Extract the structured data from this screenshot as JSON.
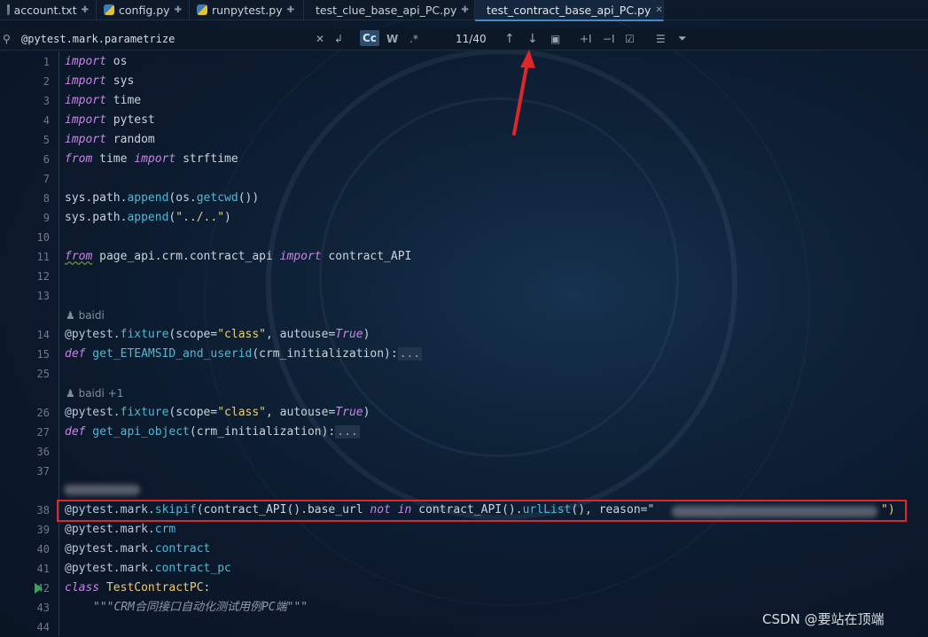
{
  "tabs": [
    {
      "label": "account.txt",
      "icon": "text-file-icon",
      "active": false
    },
    {
      "label": "config.py",
      "icon": "python-file-icon",
      "active": false
    },
    {
      "label": "runpytest.py",
      "icon": "python-file-icon",
      "active": false
    },
    {
      "label": "test_clue_base_api_PC.py",
      "icon": "python-file-icon",
      "active": false
    },
    {
      "label": "test_contract_base_api_PC.py",
      "icon": "python-file-icon",
      "active": true
    }
  ],
  "search": {
    "query": "@pytest.mark.parametrize",
    "match_case_label": "Cc",
    "words_label": "W",
    "regex_label": ".*",
    "result_count": "11/40"
  },
  "editor": {
    "line_numbers": [
      "1",
      "2",
      "3",
      "4",
      "5",
      "6",
      "7",
      "8",
      "9",
      "10",
      "11",
      "12",
      "13",
      "14",
      "15",
      "25",
      "26",
      "27",
      "36",
      "37",
      "38",
      "39",
      "40",
      "41",
      "42",
      "43",
      "44"
    ],
    "author_hints": [
      "baidi",
      "baidi +1"
    ],
    "lines": {
      "l1": {
        "kw": "import",
        "rest": " os"
      },
      "l2": {
        "kw": "import",
        "rest": " sys"
      },
      "l3": {
        "kw": "import",
        "rest": " time"
      },
      "l4": {
        "kw": "import",
        "rest": " pytest"
      },
      "l5": {
        "kw": "import",
        "rest": " random"
      },
      "l6": {
        "kw1": "from",
        "mid": " time ",
        "kw2": "import",
        "rest": " strftime"
      },
      "l8": {
        "a": "sys.path.",
        "fn1": "append",
        "b": "(os.",
        "fn2": "getcwd",
        "c": "())"
      },
      "l9": {
        "a": "sys.path.",
        "fn1": "append",
        "b": "(",
        "str": "\"../..\"",
        "c": ")"
      },
      "l11": {
        "kw1": "from",
        "mid": " page_api.crm.contract_api ",
        "kw2": "import",
        "rest": " contract_API"
      },
      "l14": {
        "dec": "@pytest.",
        "fn": "fixture",
        "a": "(scope=",
        "str": "\"class\"",
        "b": ", autouse=",
        "bool": "True",
        "c": ")"
      },
      "l15": {
        "kw": "def",
        "name": " get_ETEAMSID_and_userid",
        "args": "(crm_initialization):",
        "fold": "..."
      },
      "l26": {
        "dec": "@pytest.",
        "fn": "fixture",
        "a": "(scope=",
        "str": "\"class\"",
        "b": ", autouse=",
        "bool": "True",
        "c": ")"
      },
      "l27": {
        "kw": "def",
        "name": " get_api_object",
        "args": "(crm_initialization):",
        "fold": "..."
      },
      "l38": {
        "dec": "@pytest.mark.",
        "fn": "skipif",
        "a": "(contract_API().base_url ",
        "kw1": "not",
        "b": " ",
        "kw2": "in",
        "c": " contract_API().",
        "fn2": "urlList",
        "d": "(), reason=",
        "str_start": "\"",
        "str_end": "\")"
      },
      "l39": {
        "dec": "@pytest.mark.",
        "fn": "crm"
      },
      "l40": {
        "dec": "@pytest.mark.",
        "fn": "contract"
      },
      "l41": {
        "dec": "@pytest.mark.",
        "fn": "contract_pc"
      },
      "l42": {
        "kw": "class",
        "name": " TestContractPC",
        "c": ":"
      },
      "l43": {
        "doc": "\"\"\"CRM合同接口自动化测试用例PC端\"\"\""
      }
    }
  },
  "watermark": "CSDN @要站在顶端",
  "colors": {
    "highlight_box": "#e0262b",
    "annotation_arrow": "#e0262b"
  }
}
